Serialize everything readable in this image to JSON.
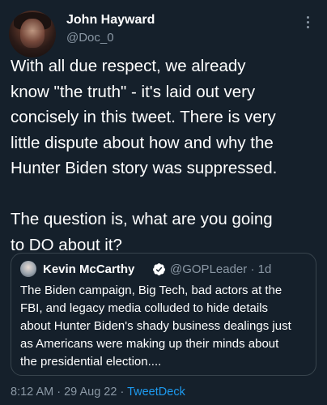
{
  "author": {
    "name": "John Hayward",
    "handle": "@Doc_0"
  },
  "tweet": {
    "text": "With all due respect, we already\nknow \"the truth\" - it's laid out very\nconcisely in this tweet. There is very\nlittle dispute about how and why the\nHunter Biden story was suppressed.\n\nThe question is, what are you going\nto DO about it?"
  },
  "quoted": {
    "name": "Kevin McCarthy",
    "handle_time": "@GOPLeader · 1d",
    "verified": true,
    "text": "The Biden campaign, Big Tech, bad actors at the\nFBI, and legacy media colluded to hide details\nabout Hunter Biden's shady business dealings just\nas Americans were making up their minds about\nthe presidential election...."
  },
  "meta": {
    "time": "8:12 AM",
    "separator": "·",
    "date": "29 Aug 22",
    "source": "TweetDeck"
  },
  "colors": {
    "background": "#15202b",
    "secondary_text": "#8b98a5",
    "accent": "#1d9bf0",
    "border": "#38444d"
  },
  "icons": [
    "more-options-icon",
    "verified-badge-icon"
  ]
}
